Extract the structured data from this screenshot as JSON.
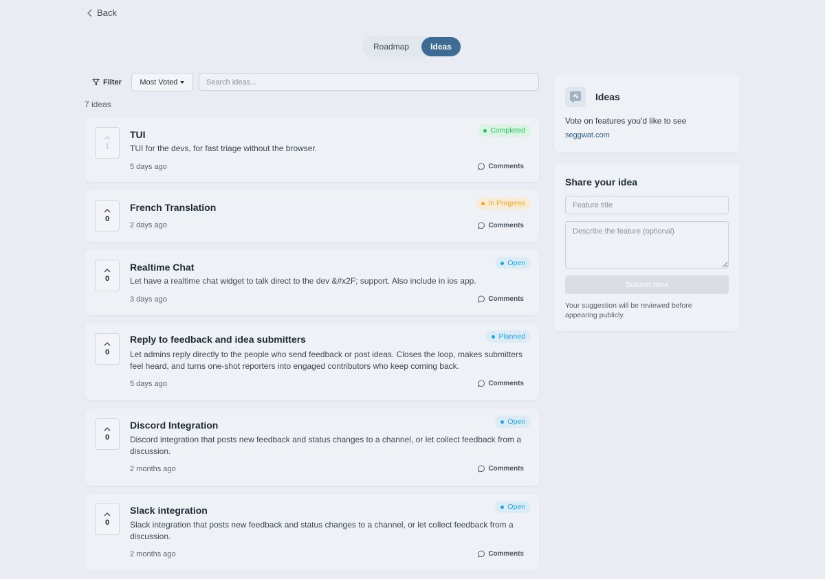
{
  "nav": {
    "back_label": "Back"
  },
  "tabs": {
    "roadmap": "Roadmap",
    "ideas": "Ideas"
  },
  "filters": {
    "filter_label": "Filter",
    "sort_value": "Most Voted",
    "search_placeholder": "Search ideas..."
  },
  "count_label": "7 ideas",
  "ideas": [
    {
      "title": "TUI",
      "description": "TUI for the devs, for fast triage without the browser.",
      "time": "5 days ago",
      "votes": "1",
      "status": "Completed",
      "status_color": "#22c55e",
      "status_bg": "#dcf3e3",
      "comments_label": "Comments"
    },
    {
      "title": "French Translation",
      "description": "",
      "time": "2 days ago",
      "votes": "0",
      "status": "In Progress",
      "status_color": "#f5a524",
      "status_bg": "#f7ecd6",
      "comments_label": "Comments"
    },
    {
      "title": "Realtime Chat",
      "description": "Let have a realtime chat widget to talk direct to the dev &#x2F; support. Also include in ios app.",
      "time": "3 days ago",
      "votes": "0",
      "status": "Open",
      "status_color": "#1aa7ec",
      "status_bg": "#dcecf7",
      "comments_label": "Comments"
    },
    {
      "title": "Reply to feedback and idea submitters",
      "description": "Let admins reply directly to the people who send feedback or post ideas. Closes the loop, makes submitters feel heard, and turns one-shot reporters into engaged contributors who keep coming back.",
      "time": "5 days ago",
      "votes": "0",
      "status": "Planned",
      "status_color": "#1aa7ec",
      "status_bg": "#dcecf7",
      "comments_label": "Comments"
    },
    {
      "title": "Discord Integration",
      "description": "Discord integration that posts new feedback and status changes to a channel, or let collect feedback from a discussion.",
      "time": "2 months ago",
      "votes": "0",
      "status": "Open",
      "status_color": "#1aa7ec",
      "status_bg": "#dcecf7",
      "comments_label": "Comments"
    },
    {
      "title": "Slack integration",
      "description": "Slack integration that posts new feedback and status changes to a channel, or let collect feedback from a discussion.",
      "time": "2 months ago",
      "votes": "0",
      "status": "Open",
      "status_color": "#1aa7ec",
      "status_bg": "#dcecf7",
      "comments_label": "Comments"
    }
  ],
  "sidebar": {
    "about": {
      "title": "Ideas",
      "description": "Vote on features you'd like to see",
      "link": "seggwat.com",
      "logo_icon": "feedback-logo-icon"
    },
    "share": {
      "title": "Share your idea",
      "title_placeholder": "Feature title",
      "desc_placeholder": "Describe the feature (optional)",
      "submit_label": "Submit Idea",
      "note": "Your suggestion will be reviewed before appearing publicly."
    }
  },
  "colors": {
    "accent": "#3d6b94",
    "link": "#2f5f8a",
    "page_bg": "#e9edf3",
    "card_bg": "#eef1f6"
  }
}
